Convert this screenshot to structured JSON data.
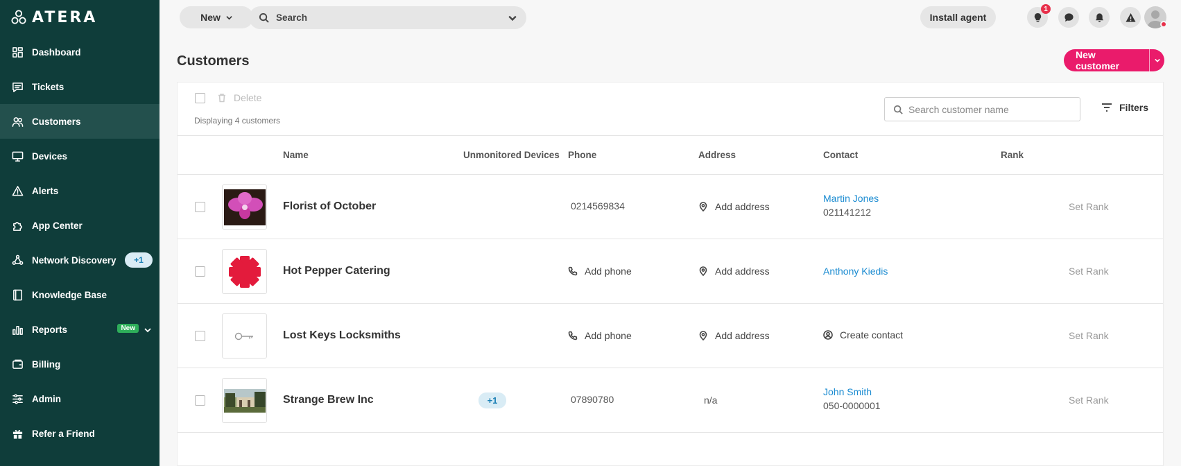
{
  "app": {
    "logo_text": "ATERA"
  },
  "sidebar": {
    "items": [
      {
        "label": "Dashboard",
        "icon": "dashboard-icon"
      },
      {
        "label": "Tickets",
        "icon": "tickets-icon"
      },
      {
        "label": "Customers",
        "icon": "customers-icon",
        "active": true
      },
      {
        "label": "Devices",
        "icon": "devices-icon"
      },
      {
        "label": "Alerts",
        "icon": "alerts-icon"
      },
      {
        "label": "App Center",
        "icon": "app-center-icon"
      },
      {
        "label": "Network Discovery",
        "icon": "network-icon",
        "badge": "+1"
      },
      {
        "label": "Knowledge Base",
        "icon": "book-icon"
      },
      {
        "label": "Reports",
        "icon": "reports-icon",
        "badge": "New"
      },
      {
        "label": "Billing",
        "icon": "billing-icon"
      },
      {
        "label": "Admin",
        "icon": "admin-icon"
      },
      {
        "label": "Refer a Friend",
        "icon": "gift-icon"
      }
    ]
  },
  "topbar": {
    "new_label": "New",
    "search_label": "Search",
    "install_label": "Install agent",
    "tips_badge": "1"
  },
  "page": {
    "title": "Customers",
    "new_customer_label": "New customer"
  },
  "toolbar": {
    "delete_label": "Delete",
    "displaying_text": "Displaying 4 customers",
    "search_placeholder": "Search customer name",
    "filters_label": "Filters"
  },
  "table": {
    "columns": [
      "Name",
      "Unmonitored Devices",
      "Phone",
      "Address",
      "Contact",
      "Rank"
    ],
    "rows": [
      {
        "name": "Florist of October",
        "unmonitored": "",
        "phone": "0214569834",
        "address": "Add address",
        "contact_name": "Martin Jones",
        "contact_phone": "021141212",
        "rank": "Set Rank"
      },
      {
        "name": "Hot Pepper Catering",
        "unmonitored": "",
        "phone": "Add phone",
        "address": "Add address",
        "contact_name": "Anthony Kiedis",
        "contact_phone": "",
        "rank": "Set Rank"
      },
      {
        "name": "Lost Keys Locksmiths",
        "unmonitored": "",
        "phone": "Add phone",
        "address": "Add address",
        "contact_name": "Create contact",
        "contact_phone": "",
        "rank": "Set Rank"
      },
      {
        "name": "Strange Brew Inc",
        "unmonitored": "+1",
        "phone": "07890780",
        "address": "n/a",
        "contact_name": "John Smith",
        "contact_phone": "050-0000001",
        "rank": "Set Rank"
      }
    ]
  },
  "colors": {
    "sidebar_bg": "#0f3d3a",
    "accent": "#ea1b6b",
    "link": "#1a8bd1",
    "badge_red": "#e8304b"
  }
}
